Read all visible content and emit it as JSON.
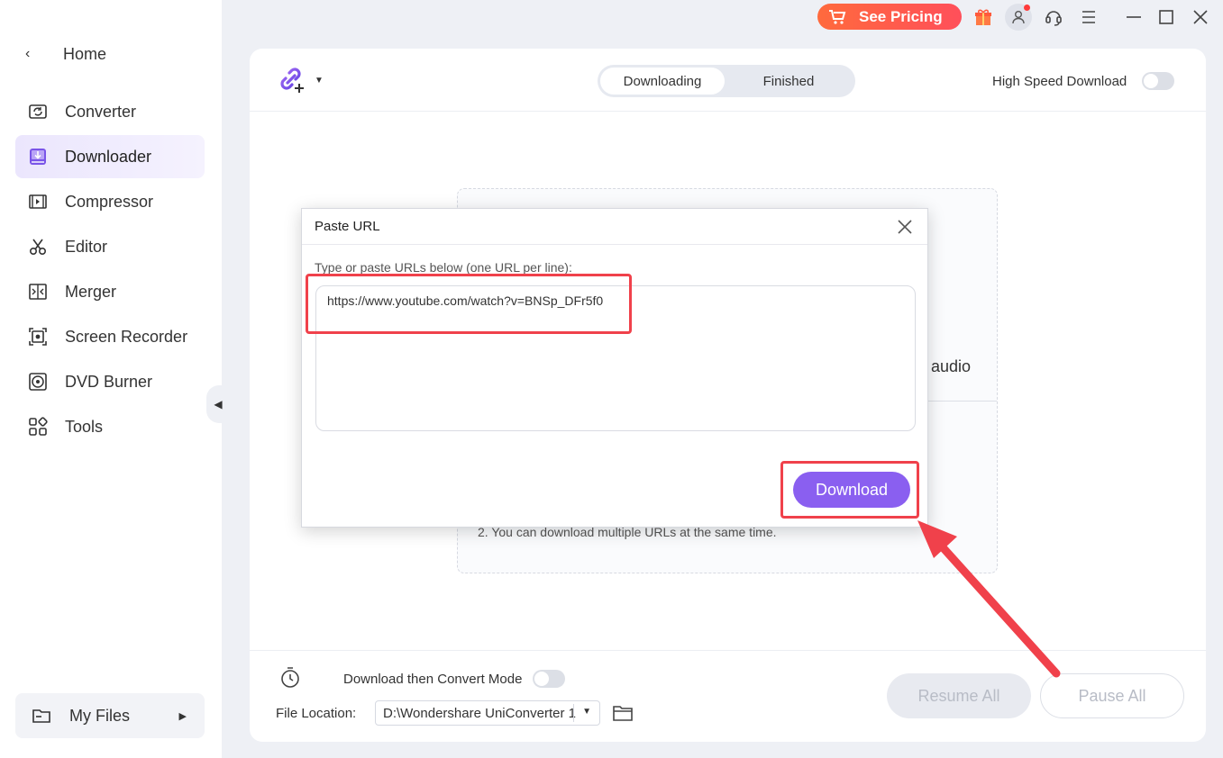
{
  "sidebar": {
    "home_label": "Home",
    "items": [
      {
        "label": "Converter",
        "icon": "converter-icon"
      },
      {
        "label": "Downloader",
        "icon": "downloader-icon",
        "active": true
      },
      {
        "label": "Compressor",
        "icon": "compressor-icon"
      },
      {
        "label": "Editor",
        "icon": "scissors-icon"
      },
      {
        "label": "Merger",
        "icon": "merger-icon"
      },
      {
        "label": "Screen Recorder",
        "icon": "screen-recorder-icon"
      },
      {
        "label": "DVD Burner",
        "icon": "disc-icon"
      },
      {
        "label": "Tools",
        "icon": "tools-grid-icon"
      }
    ],
    "my_files_label": "My Files"
  },
  "titlebar": {
    "see_pricing_label": "See Pricing",
    "icons": [
      "gift-icon",
      "user-avatar-icon",
      "headset-icon",
      "menu-icon",
      "minimize-icon",
      "maximize-icon",
      "close-icon"
    ]
  },
  "downloader": {
    "tabs": [
      "Downloading",
      "Finished"
    ],
    "active_tab": "Downloading",
    "high_speed_label": "High Speed Download",
    "high_speed_on": false,
    "background_partial_text": "l audio",
    "background_note": "2. You can download multiple URLs at the same time.",
    "convert_mode_label": "Download then Convert Mode",
    "convert_mode_on": false,
    "file_location_label": "File Location:",
    "file_location_value": "D:\\Wondershare UniConverter 1",
    "resume_all_label": "Resume All",
    "pause_all_label": "Pause All"
  },
  "dialog": {
    "title": "Paste URL",
    "instruction": "Type or paste URLs below (one URL per line):",
    "url_value": "https://www.youtube.com/watch?v=BNSp_DFr5f0",
    "download_label": "Download"
  },
  "colors": {
    "accent_purple": "#8a5ff0",
    "pricing_orange": "#ff5a45",
    "annotation_red": "#f0414b",
    "active_nav_bg": "#ebe6fd"
  }
}
